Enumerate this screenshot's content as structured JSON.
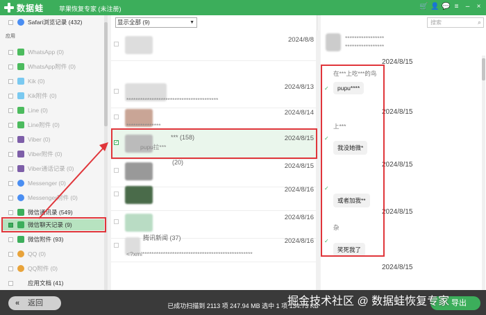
{
  "titlebar": {
    "app_name": "数据蛙",
    "subtitle": "苹果恢复专家 (未注册)",
    "icons": [
      "shopping-cart-icon",
      "user-icon",
      "chat-icon",
      "menu-icon",
      "minimize-icon",
      "close-icon"
    ]
  },
  "sidebar": {
    "safari": "Safari浏览记录 (432)",
    "section_apps": "应用",
    "items": [
      {
        "label": "WhatsApp (0)",
        "color": "#4cbb5e"
      },
      {
        "label": "WhatsApp附件 (0)",
        "color": "#4cbb5e"
      },
      {
        "label": "Kik (0)",
        "color": "#7ac9f0"
      },
      {
        "label": "Kik附件 (0)",
        "color": "#7ac9f0"
      },
      {
        "label": "Line (0)",
        "color": "#4cbb5e"
      },
      {
        "label": "Line附件 (0)",
        "color": "#4cbb5e"
      },
      {
        "label": "Viber (0)",
        "color": "#7d5ea8"
      },
      {
        "label": "Viber附件 (0)",
        "color": "#7d5ea8"
      },
      {
        "label": "Viber通话记录 (0)",
        "color": "#7d5ea8"
      },
      {
        "label": "Messenger (0)",
        "color": "#4a8ef2"
      },
      {
        "label": "Messenger附件 (0)",
        "color": "#4a8ef2"
      },
      {
        "label": "微信通讯录 (549)",
        "color": "#3cae5b"
      },
      {
        "label": "微信聊天记录 (9)",
        "color": "#3cae5b"
      },
      {
        "label": "微信附件 (93)",
        "color": "#3cae5b"
      },
      {
        "label": "QQ (0)",
        "color": "#e8a33a"
      },
      {
        "label": "QQ附件 (0)",
        "color": "#e8a33a"
      },
      {
        "label": "应用文档 (41)",
        "color": ""
      }
    ]
  },
  "filter": {
    "value": "显示全部 (9)"
  },
  "conversations": [
    {
      "name": "",
      "snippet": "",
      "date": "2024/8/8"
    },
    {
      "name": "",
      "snippet": "****************************************",
      "date": "2024/8/13"
    },
    {
      "name": "",
      "snippet": "***************",
      "date": "2024/8/14"
    },
    {
      "name": "*** (158)",
      "snippet": "pupu拉***",
      "date": "2024/8/15"
    },
    {
      "name": "(20)",
      "snippet": "",
      "date": "2024/8/15"
    },
    {
      "name": "",
      "snippet": "",
      "date": "2024/8/16"
    },
    {
      "name": "",
      "snippet": "",
      "date": "2024/8/16"
    },
    {
      "name": "腾讯新闻 (37)",
      "snippet": "<?xml************************************************",
      "date": "2024/8/16"
    }
  ],
  "search": {
    "placeholder": "搜索"
  },
  "chat": {
    "header_name": "*****************",
    "header_sub": "*****************",
    "date_1": "2024/8/15",
    "sender_1": "在***上吃***的鸟",
    "msg_1": "pupu****",
    "date_2": "2024/8/15",
    "sender_2": "上***",
    "msg_2": "我没她微*",
    "date_3": "2024/8/15",
    "msg_3": "或者加我**",
    "date_4": "2024/8/15",
    "sender_4": "杂",
    "msg_4": "笑死我了",
    "date_5": "2024/8/15"
  },
  "bottom": {
    "back_label": "返回",
    "status": "已成功扫描到 2113 项 247.94 MB  选中 1 项 134.73 KB",
    "export_label": "导出",
    "watermark": "掘金技术社区 @ 数据蛙恢复专家"
  }
}
